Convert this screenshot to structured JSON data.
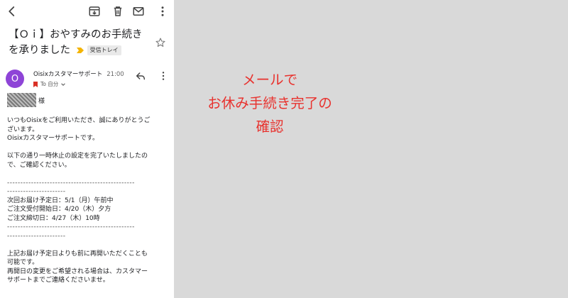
{
  "toolbar": {
    "back_icon": "back-arrow-icon",
    "archive_icon": "archive-icon",
    "delete_icon": "trash-icon",
    "mark_unread_icon": "mail-icon",
    "more_icon": "more-vert-icon"
  },
  "email": {
    "subject": "【Ｏｉ】おやすみのお手続きを承りました",
    "label": "受信トレイ",
    "label_color": "#f4b400",
    "sender_initial": "O",
    "avatar_color": "#8e44d7",
    "sender_name": "Oisixカスタマーサポート",
    "time": "21:00",
    "to": "To 自分",
    "salutation_suffix": "様",
    "body_lines": [
      "いつもOisixをご利用いただき、誠にありがとうご",
      "ざいます。",
      "Oisixカスタマーサポートです。",
      "",
      "以下の通り一時休止の設定を完了いたしましたの",
      "で、ご確認ください。",
      "",
      "------------------------------------------------",
      "----------------------",
      "次回お届け予定日：5/1（月）午前中",
      "ご注文受付開始日：4/20（木）夕方",
      "ご注文締切日：4/27（木）10時",
      "------------------------------------------------",
      "----------------------",
      "",
      "上記お届け予定日よりも前に再開いただくことも",
      "可能です。",
      "再開日の変更をご希望される場合は、カスタマー",
      "サポートまでご連絡くださいませ。"
    ]
  },
  "annotation": {
    "line1": "メールで",
    "line2": "お休み手続き完了の",
    "line3": "確認",
    "color": "#e8322e"
  }
}
